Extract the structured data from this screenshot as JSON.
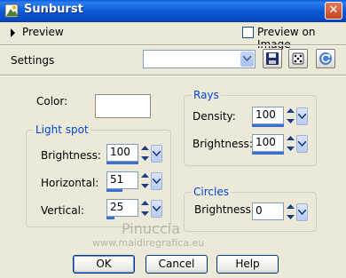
{
  "window": {
    "title": "Sunburst",
    "close_label": "✕"
  },
  "header": {
    "preview_label": "Preview",
    "preview_on_image_label": "Preview on Image",
    "preview_on_image_checked": false,
    "settings_label": "Settings",
    "settings_value": ""
  },
  "color": {
    "label": "Color:",
    "value": "#ffffff"
  },
  "light_spot": {
    "title": "Light spot",
    "brightness": {
      "label": "Brightness:",
      "value": "100",
      "level": 1.0
    },
    "horizontal": {
      "label": "Horizontal:",
      "value": "51",
      "level": 0.51
    },
    "vertical": {
      "label": "Vertical:",
      "value": "25",
      "level": 0.25
    }
  },
  "rays": {
    "title": "Rays",
    "density": {
      "label": "Density:",
      "value": "100",
      "level": 1.0
    },
    "brightness": {
      "label": "Brightness:",
      "value": "100",
      "level": 1.0
    }
  },
  "circles": {
    "title": "Circles",
    "brightness": {
      "label": "Brightness:",
      "value": "0",
      "level": 0.0
    }
  },
  "buttons": {
    "ok": "OK",
    "cancel": "Cancel",
    "help": "Help"
  },
  "watermark": {
    "line1": "Pinuccia",
    "line2": "www.maidiregrafica.eu"
  },
  "colors": {
    "titlebar": "#0b58d4",
    "group_title": "#0046d5",
    "dialog_bg": "#ece9d8",
    "slider_fill": "#3a6fd6"
  },
  "icons": {
    "save": "save-floppy-icon",
    "random": "dice-icon",
    "reset": "reset-arrow-icon",
    "app": "app-icon"
  }
}
